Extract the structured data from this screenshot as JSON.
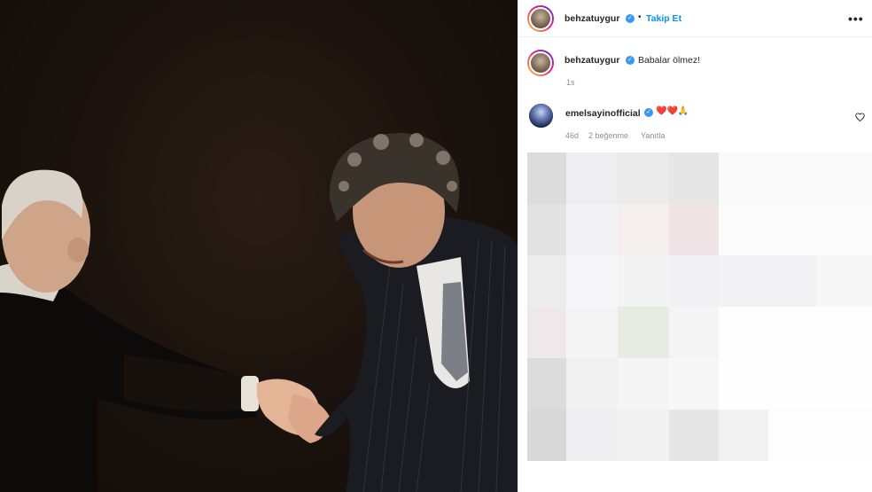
{
  "post": {
    "author": "behzatuygur",
    "follow_label": "Takip Et",
    "separator": "•",
    "more_label": "•••",
    "caption": "Babalar ölmez!",
    "caption_time": "1s"
  },
  "comment": {
    "author": "emelsayinofficial",
    "text": "❤️❤️🙏",
    "time": "46d",
    "likes": "2 beğenme",
    "reply_label": "Yanıtla"
  },
  "icons": {
    "verified": "verified-badge-icon",
    "heart": "heart-outline-icon",
    "more": "more-options-icon"
  },
  "colors": {
    "accent": "#0095f6",
    "verified": "#3897f0",
    "text": "#262626",
    "muted": "#8e8e8e"
  }
}
